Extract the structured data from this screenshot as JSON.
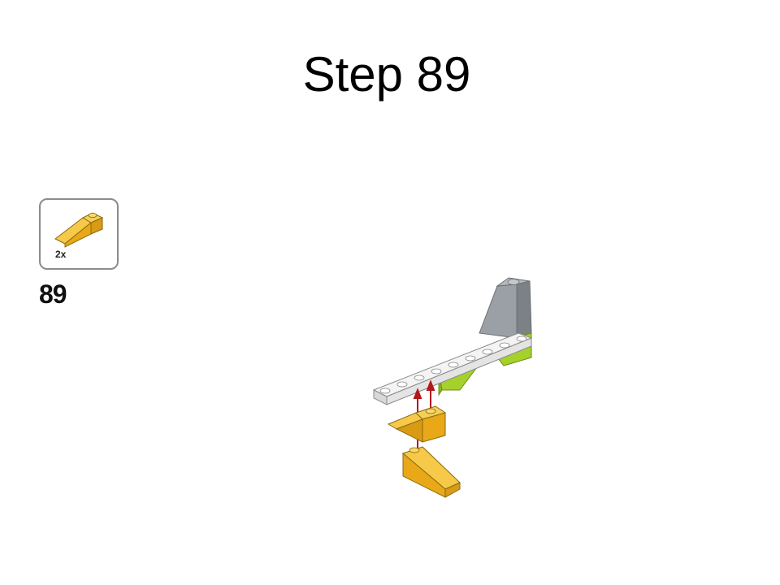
{
  "slide": {
    "title": "Step 89"
  },
  "parts_list": {
    "quantity": "2x",
    "part_icon": "yellow-slope-brick-icon",
    "part_color": "#f2b01e"
  },
  "step_number": "89",
  "colors": {
    "yellow": "#f2b01e",
    "lime": "#a5d12a",
    "gray": "#9aa0a6",
    "white_plate": "#f4f4f4",
    "arrow": "#b3171b"
  }
}
